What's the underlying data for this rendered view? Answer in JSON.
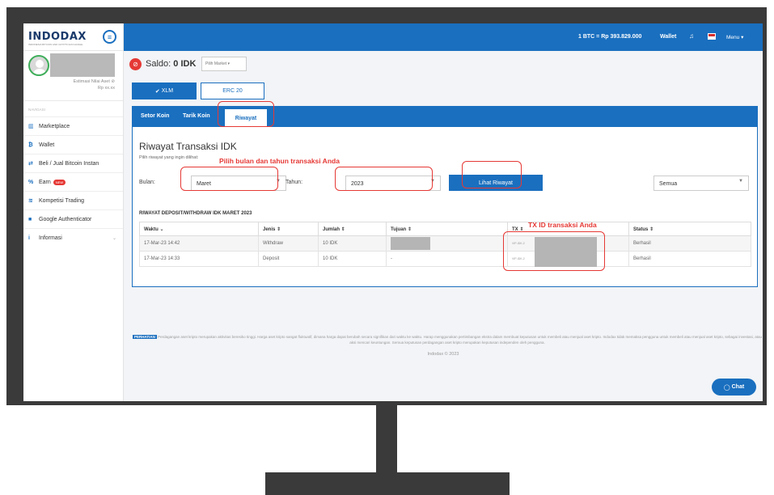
{
  "brand": {
    "name": "INDODAX",
    "tagline": "INDONESIA BITCOIN AND CRYPTO EXCHANGE"
  },
  "profile": {
    "estimasi_label": "Estimasi Nilai Aset",
    "estimasi_value": "Rp xx.xx"
  },
  "sidebar": {
    "section_label": "NAVIGASI",
    "items": [
      {
        "label": "Marketplace",
        "icon": "chart-bars-icon"
      },
      {
        "label": "Wallet",
        "icon": "bitcoin-icon"
      },
      {
        "label": "Beli / Jual Bitcoin Instan",
        "icon": "exchange-arrows-icon"
      },
      {
        "label": "Earn",
        "icon": "percent-icon",
        "badge": "NEW"
      },
      {
        "label": "Kompetisi Trading",
        "icon": "chart-bars-icon"
      },
      {
        "label": "Google Authenticator",
        "icon": "lock-icon"
      },
      {
        "label": "Informasi",
        "icon": "info-icon"
      }
    ]
  },
  "topbar": {
    "btc_rate": "1 BTC = Rp 393.829.000",
    "wallet": "Wallet",
    "menu": "Menu"
  },
  "saldo": {
    "label": "Saldo:",
    "value": "0 IDK",
    "market_placeholder": "Pilih Market"
  },
  "network": {
    "xlm": "XLM",
    "erc20": "ERC 20"
  },
  "tabs": {
    "setor": "Setor Koin",
    "tarik": "Tarik Koin",
    "riwayat": "Riwayat"
  },
  "riwayat": {
    "title": "Riwayat Transaksi IDK",
    "hint": "Pilih riwayat yang ingin dilihat:",
    "bulan_label": "Bulan:",
    "bulan_value": "Maret",
    "tahun_label": "Tahun:",
    "tahun_value": "2023",
    "lihat_button": "Lihat Riwayat",
    "filter_value": "Semua",
    "caption": "RIWAYAT DEPOSIT/WITHDRAW IDK MARET 2023"
  },
  "table": {
    "headers": [
      "Waktu",
      "Jenis",
      "Jumlah",
      "Tujuan",
      "TX",
      "Status"
    ],
    "rows": [
      {
        "waktu": "17-Mar-23 14:42",
        "jenis": "Withdraw",
        "jumlah": "10 IDK",
        "tujuan": "",
        "tx": "VIP-IDK-2",
        "status": "Berhasil"
      },
      {
        "waktu": "17-Mar-23 14:33",
        "jenis": "Deposit",
        "jumlah": "10 IDK",
        "tujuan": "-",
        "tx": "VIP-IDK-2",
        "status": "Berhasil"
      }
    ]
  },
  "footer": {
    "perhatian": "PERHATIAN",
    "note": "Perdagangan aset kripto merupakan aktivitas beresiko tinggi. Harga aset kripto sangat fluktuatif, dimana harga dapat berubah secara signifikan dari waktu ke waktu. Harap menggunakan pertimbangan ekstra dalam membuat keputusan untuk membeli atau menjual aset kripto. Indodax tidak memaksa pengguna untuk membeli atau menjual aset kripto, sebagai investasi, atau aksi mencari keuntungan. Semua keputusan perdagangan aset kripto merupakan keputusan independen oleh pengguna.",
    "copyright": "Indodax © 2023"
  },
  "chat": {
    "label": "Chat"
  },
  "annotations": {
    "month_year_note": "Pilih bulan dan tahun transaksi Anda",
    "tx_note": "TX ID transaksi Anda"
  },
  "colors": {
    "primary": "#1a6fbf",
    "annotation": "#e53935"
  }
}
